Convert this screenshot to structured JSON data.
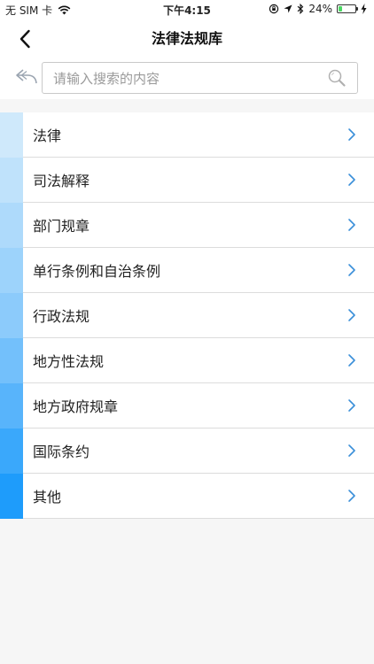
{
  "status_bar": {
    "carrier": "无 SIM 卡",
    "time": "下午4:15",
    "battery_percent": "24%",
    "battery_level": 0.24
  },
  "nav": {
    "title": "法律法规库"
  },
  "search": {
    "placeholder": "请输入搜索的内容",
    "value": ""
  },
  "categories": [
    {
      "label": "法律",
      "accent": "#cfe9fb"
    },
    {
      "label": "司法解释",
      "accent": "#bfe2fb"
    },
    {
      "label": "部门规章",
      "accent": "#aedafb"
    },
    {
      "label": "单行条例和自治条例",
      "accent": "#9dd3fb"
    },
    {
      "label": "行政法规",
      "accent": "#8ccbfb"
    },
    {
      "label": "地方性法规",
      "accent": "#73c0fb"
    },
    {
      "label": "地方政府规章",
      "accent": "#58b4fb"
    },
    {
      "label": "国际条约",
      "accent": "#3aa8fb"
    },
    {
      "label": "其他",
      "accent": "#1e9cfb"
    }
  ],
  "colors": {
    "chevron": "#3a8fd9",
    "divider": "#dcdcdc"
  },
  "icons": {
    "back": "chevron-left-icon",
    "undo": "undo-arrow-icon",
    "search": "search-icon",
    "row": "chevron-right-icon"
  }
}
